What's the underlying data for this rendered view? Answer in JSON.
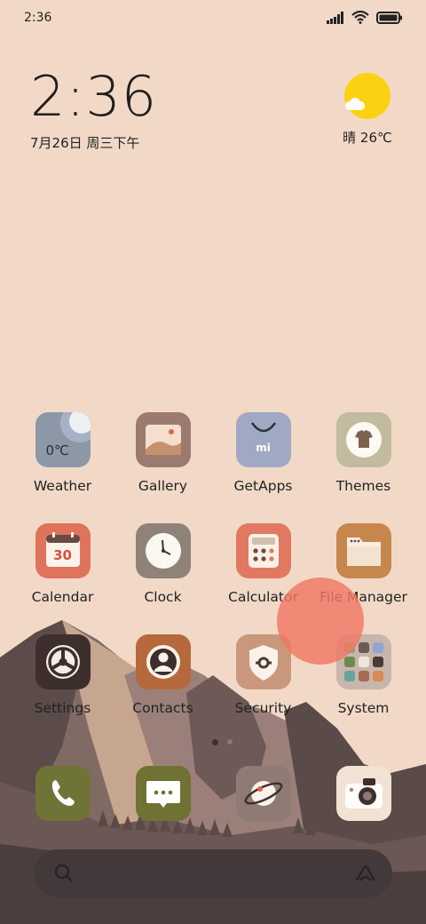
{
  "status_bar": {
    "time": "2:36",
    "icons": [
      "signal-icon",
      "wifi-icon",
      "battery-icon"
    ]
  },
  "clock_widget": {
    "time": "2:36",
    "date": "7月26日 周三下午"
  },
  "weather_widget": {
    "text": "晴 26℃",
    "icon": "sunny-partly-cloudy-icon"
  },
  "apps": [
    {
      "label": "Weather",
      "icon": "weather-icon",
      "badge": "0℃"
    },
    {
      "label": "Gallery",
      "icon": "gallery-icon"
    },
    {
      "label": "GetApps",
      "icon": "getapps-icon",
      "badge": "mi"
    },
    {
      "label": "Themes",
      "icon": "themes-icon"
    },
    {
      "label": "Calendar",
      "icon": "calendar-icon",
      "badge": "30"
    },
    {
      "label": "Clock",
      "icon": "clock-icon"
    },
    {
      "label": "Calculator",
      "icon": "calculator-icon"
    },
    {
      "label": "File Manager",
      "icon": "file-manager-icon"
    },
    {
      "label": "Settings",
      "icon": "settings-icon"
    },
    {
      "label": "Contacts",
      "icon": "contacts-icon"
    },
    {
      "label": "Security",
      "icon": "security-icon"
    },
    {
      "label": "System",
      "icon": "system-folder-icon"
    }
  ],
  "page_indicator": {
    "pages": 2,
    "current": 1
  },
  "dock": [
    "phone-icon",
    "messages-icon",
    "browser-icon",
    "camera-icon"
  ],
  "search_bar": {
    "left_icon": "search-icon",
    "right_icon": "assistant-icon"
  },
  "colors": {
    "background": "#f2d9c7",
    "sun": "#fcd113",
    "mountain_dark": "#4b3f3e",
    "touch_indicator": "#f27864"
  }
}
